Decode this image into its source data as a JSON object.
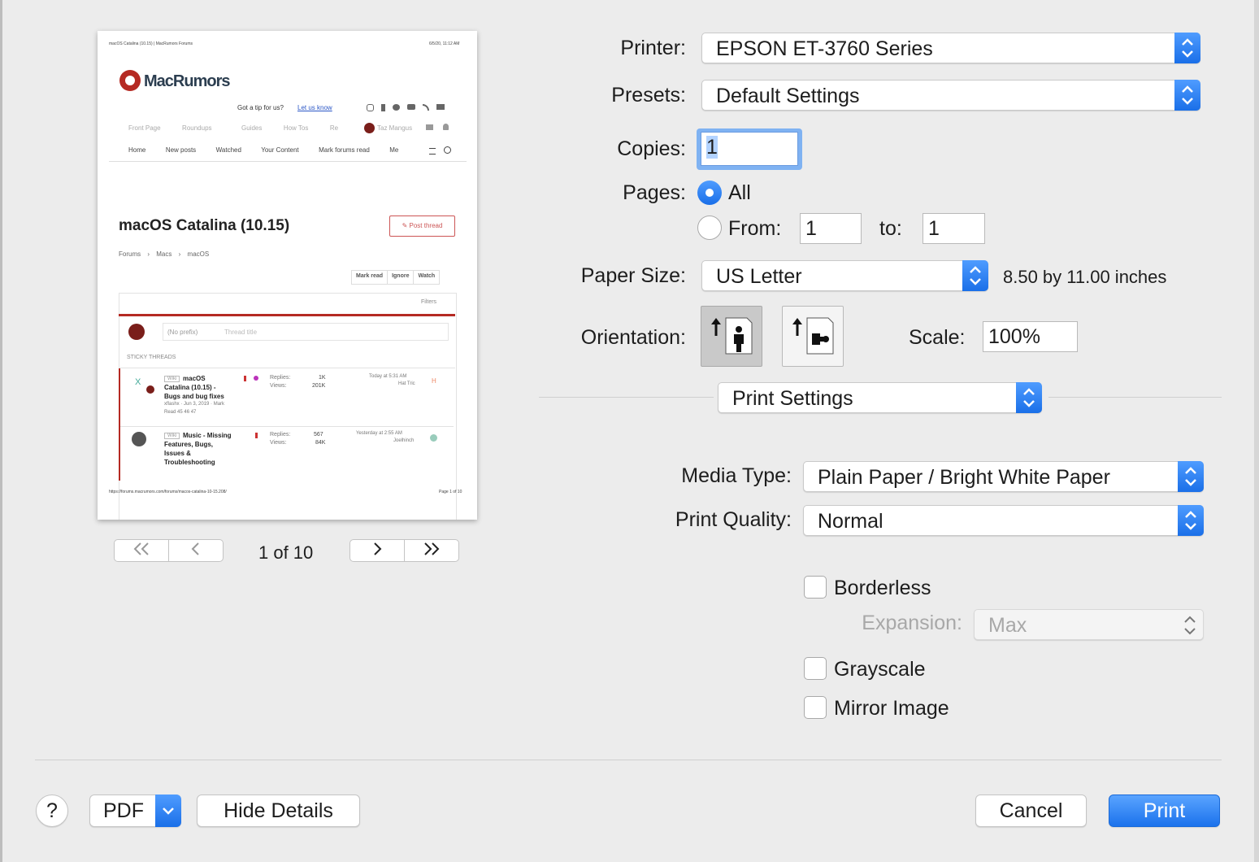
{
  "preview": {
    "page_header_left": "macOS Catalina (10.15) | MacRumors Forums",
    "page_header_right": "6/5/20, 11:12 AM",
    "logo_text": "MacRumors",
    "tip_text": "Got a tip for us?",
    "tip_link": "Let us know",
    "nav1": [
      "Front Page",
      "Roundups",
      "Guides",
      "How Tos",
      "Re",
      "Taz Mangus"
    ],
    "nav2": [
      "Home",
      "New posts",
      "Watched",
      "Your Content",
      "Mark forums read",
      "Me"
    ],
    "thread_title": "macOS Catalina (10.15)",
    "post_thread": "Post thread",
    "breadcrumb": [
      "Forums",
      "Macs",
      "macOS"
    ],
    "actions": [
      "Mark read",
      "Ignore",
      "Watch"
    ],
    "filters": "Filters",
    "prefix": "(No prefix)",
    "thread_title_placeholder": "Thread title",
    "sticky_label": "STICKY THREADS",
    "threads": [
      {
        "tag": "Wiki",
        "title1": "macOS",
        "title2": "Catalina (10.15) -",
        "title3": "Bugs and bug fixes",
        "meta": "xflashx · Jun 3, 2019 · Mark",
        "pages": "Read   45   46   47",
        "replies_label": "Replies:",
        "views_label": "Views:",
        "replies": "1K",
        "views": "201K",
        "last": "Today at 5:31 AM",
        "last_user": "Hat Tric"
      },
      {
        "tag": "Wiki",
        "title1": "Music - Missing",
        "title2": "Features, Bugs,",
        "title3": "Issues &",
        "title4": "Troubleshooting",
        "replies_label": "Replies:",
        "views_label": "Views:",
        "replies": "567",
        "views": "84K",
        "last": "Yesterday at 2:55 AM",
        "last_user": "Joelhinch"
      }
    ],
    "footer_url": "https://forums.macrumors.com/forums/macos-catalina-10-15.208/",
    "footer_page": "Page 1 of 10",
    "page_indicator": "1 of 10"
  },
  "printer": {
    "label": "Printer:",
    "value": "EPSON ET-3760 Series"
  },
  "presets": {
    "label": "Presets:",
    "value": "Default Settings"
  },
  "copies": {
    "label": "Copies:",
    "value": "1"
  },
  "pages": {
    "label": "Pages:",
    "all_label": "All",
    "from_label": "From:",
    "from_value": "1",
    "to_label": "to:",
    "to_value": "1"
  },
  "paper_size": {
    "label": "Paper Size:",
    "value": "US Letter",
    "dimensions": "8.50 by 11.00 inches"
  },
  "orientation": {
    "label": "Orientation:"
  },
  "scale": {
    "label": "Scale:",
    "value": "100%"
  },
  "section": {
    "value": "Print Settings"
  },
  "media_type": {
    "label": "Media Type:",
    "value": "Plain Paper / Bright White Paper"
  },
  "print_quality": {
    "label": "Print Quality:",
    "value": "Normal"
  },
  "borderless": {
    "label": "Borderless"
  },
  "expansion": {
    "label": "Expansion:",
    "value": "Max"
  },
  "grayscale": {
    "label": "Grayscale"
  },
  "mirror": {
    "label": "Mirror Image"
  },
  "footer": {
    "help": "?",
    "pdf": "PDF",
    "hide_details": "Hide Details",
    "cancel": "Cancel",
    "print": "Print"
  },
  "colors": {
    "accent": "#1a6fe8",
    "macrumors_red": "#b52a23"
  }
}
